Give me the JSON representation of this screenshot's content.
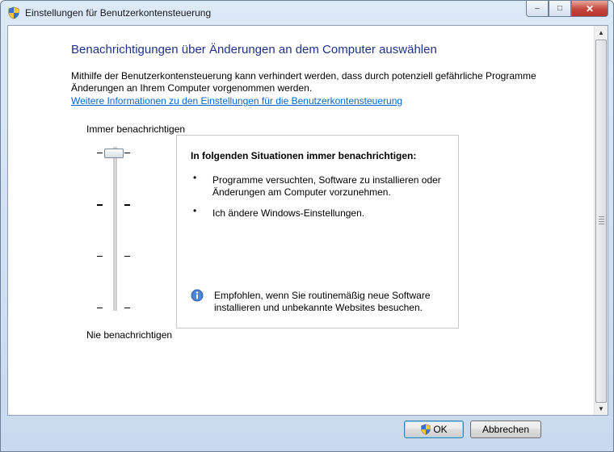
{
  "window": {
    "title": "Einstellungen für Benutzerkontensteuerung",
    "icon": "uac-shield-icon",
    "caption_buttons": {
      "minimize": "–",
      "maximize": "□",
      "close": "✕"
    }
  },
  "content": {
    "heading": "Benachrichtigungen über Änderungen an dem Computer auswählen",
    "description": "Mithilfe der Benutzerkontensteuerung kann verhindert werden, dass durch potenziell gefährliche Programme Änderungen an Ihrem Computer vorgenommen werden.",
    "link": "Weitere Informationen zu den Einstellungen für die Benutzerkontensteuerung"
  },
  "slider": {
    "top_label": "Immer benachrichtigen",
    "bottom_label": "Nie benachrichtigen",
    "levels": 4,
    "selected_level": 4
  },
  "info_panel": {
    "title": "In folgenden Situationen immer benachrichtigen:",
    "bullets": [
      "Programme versuchten, Software zu installieren oder Änderungen am Computer vorzunehmen.",
      "Ich ändere Windows-Einstellungen."
    ],
    "bullet_glyph": "•",
    "recommendation": "Empfohlen, wenn Sie routinemäßig neue Software installieren und unbekannte Websites besuchen.",
    "recommendation_icon": "info-icon"
  },
  "buttons": {
    "ok": "OK",
    "cancel": "Abbrechen"
  },
  "colors": {
    "heading": "#1e3287",
    "link": "#0066cc"
  }
}
